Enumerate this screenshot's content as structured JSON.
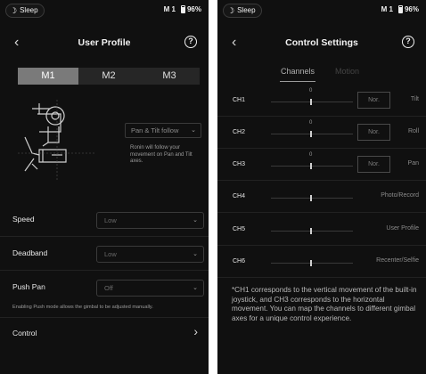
{
  "left": {
    "status": {
      "sleep_label": "Sleep",
      "mode": "M 1",
      "battery": "96%"
    },
    "nav": {
      "title": "User Profile"
    },
    "profiles": [
      "M1",
      "M2",
      "M3"
    ],
    "active_profile": "M1",
    "follow": {
      "value": "Pan & Tilt follow",
      "description": "Ronin will follow your movement on Pan and Tilt axes."
    },
    "settings": [
      {
        "label": "Speed",
        "value": "Low"
      },
      {
        "label": "Deadband",
        "value": "Low"
      },
      {
        "label": "Push Pan",
        "value": "Off"
      }
    ],
    "push_note": "Enabling Push mode allows the gimbal to be adjusted manually.",
    "control_label": "Control"
  },
  "right": {
    "status": {
      "sleep_label": "Sleep",
      "mode": "M 1",
      "battery": "96%"
    },
    "nav": {
      "title": "Control Settings"
    },
    "tabs": {
      "active": "Channels",
      "inactive": "Motion"
    },
    "channels": [
      {
        "label": "CH1",
        "zero": "0",
        "nor": "Nor.",
        "function": "Tilt"
      },
      {
        "label": "CH2",
        "zero": "0",
        "nor": "Nor.",
        "function": "Roll"
      },
      {
        "label": "CH3",
        "zero": "0",
        "nor": "Nor.",
        "function": "Pan"
      },
      {
        "label": "CH4",
        "function": "Photo/Record"
      },
      {
        "label": "CH5",
        "function": "User Profile"
      },
      {
        "label": "CH6",
        "function": "Recenter/Selfie"
      }
    ],
    "note": "*CH1 corresponds to the vertical movement of the built-in joystick, and CH3 corresponds to the horizontal movement. You can map the channels to different gimbal axes for a unique control experience."
  },
  "icons": [
    "moon-icon",
    "battery-icon",
    "back-icon",
    "help-icon",
    "chevron-down-icon",
    "chevron-right-icon",
    "gimbal-illustration"
  ]
}
